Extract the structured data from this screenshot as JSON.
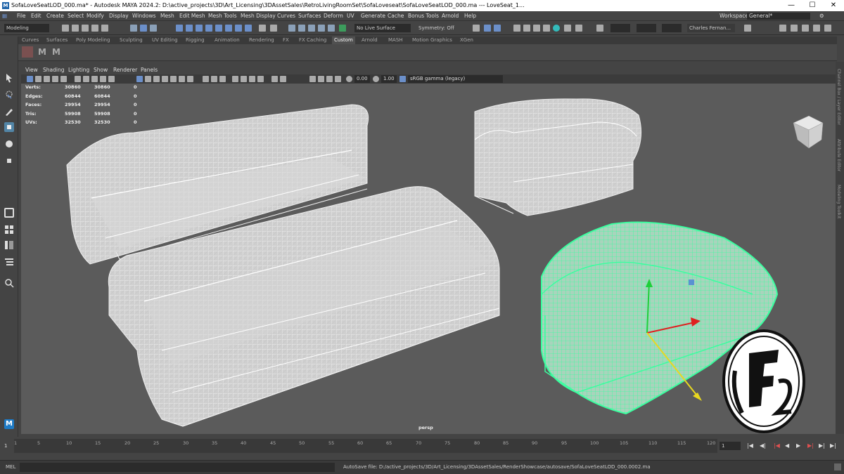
{
  "window": {
    "title": "SofaLoveSeatLOD_000.ma* - Autodesk MAYA 2024.2: D:\\active_projects\\3D\\Art_Licensing\\3DAssetSales\\RetroLivingRoomSet\\SofaLoveseat\\SofaLoveSeatLOD_000.ma   ---   LoveSeat_1...",
    "minimize": "—",
    "maximize": "☐",
    "close": "✕"
  },
  "menubar": [
    "File",
    "Edit",
    "Create",
    "Select",
    "Modify",
    "Display",
    "Windows",
    "Mesh",
    "Edit Mesh",
    "Mesh Tools",
    "Mesh Display",
    "Curves",
    "Surfaces",
    "Deform",
    "UV",
    "Generate",
    "Cache",
    "Bonus Tools",
    "Arnold",
    "Help"
  ],
  "workspace": {
    "label": "Workspace:",
    "value": "General*"
  },
  "statusline": {
    "mode": "Modeling",
    "live_surface": "No Live Surface",
    "symmetry": "Symmetry: Off",
    "user": "Charles Fernan..."
  },
  "shelf_tabs": [
    "Curves",
    "Surfaces",
    "Poly Modeling",
    "Sculpting",
    "UV Editing",
    "Rigging",
    "Animation",
    "Rendering",
    "FX",
    "FX Caching",
    "Custom",
    "Arnold",
    "MASH",
    "Motion Graphics",
    "XGen"
  ],
  "shelf_active": "Custom",
  "shelf_icons": [
    "M",
    "M"
  ],
  "viewport": {
    "menus": [
      "View",
      "Shading",
      "Lighting",
      "Show",
      "Renderer",
      "Panels"
    ],
    "exposure": "0.00",
    "gamma": "1.00",
    "color_space": "sRGB gamma (legacy)",
    "camera": "persp"
  },
  "hud": [
    {
      "label": "Verts:",
      "a": "30860",
      "b": "30860",
      "c": "0"
    },
    {
      "label": "Edges:",
      "a": "60844",
      "b": "60844",
      "c": "0"
    },
    {
      "label": "Faces:",
      "a": "29954",
      "b": "29954",
      "c": "0"
    },
    {
      "label": "Tris:",
      "a": "59908",
      "b": "59908",
      "c": "0"
    },
    {
      "label": "UVs:",
      "a": "32530",
      "b": "32530",
      "c": "0"
    }
  ],
  "right_tabs": [
    "Channel Box / Layer Editor",
    "Attribute Editor",
    "Modeling Toolkit"
  ],
  "timeline": {
    "ticks": [
      "1",
      "5",
      "10",
      "15",
      "20",
      "25",
      "30",
      "35",
      "40",
      "45",
      "50",
      "55",
      "60",
      "65",
      "70",
      "75",
      "80",
      "85",
      "90",
      "95",
      "100",
      "105",
      "110",
      "115",
      "120"
    ],
    "current_frame": "1",
    "playback": [
      "|◀",
      "◀|",
      "◀",
      "▶",
      "▶|",
      "▶|"
    ]
  },
  "cmdline": {
    "language": "MEL",
    "message": "AutoSave file: D:/active_projects/3D/Art_Licensing/3DAssetSales/RenderShowcase/autosave/SofaLoveSeatLOD_000.0002.ma"
  },
  "colors": {
    "selection": "#3bffa0",
    "wire": "#e8e8e8",
    "viewport_bg": "#5b5b5b"
  },
  "maya_logo": "M"
}
